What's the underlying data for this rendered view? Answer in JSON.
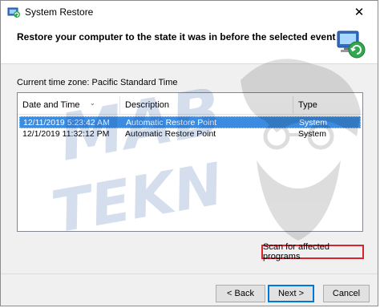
{
  "window": {
    "title": "System Restore",
    "close_glyph": "✕"
  },
  "header": {
    "text": "Restore your computer to the state it was in before the selected event",
    "icon": "system-restore-icon"
  },
  "timezone_label": "Current time zone: Pacific Standard Time",
  "table": {
    "columns": [
      "Date and Time",
      "Description",
      "Type"
    ],
    "rows": [
      {
        "date": "12/11/2019 5:23:42 AM",
        "description": "Automatic Restore Point",
        "type": "System",
        "selected": true
      },
      {
        "date": "12/1/2019 11:32:12 PM",
        "description": "Automatic Restore Point",
        "type": "System",
        "selected": false
      }
    ]
  },
  "buttons": {
    "scan": "Scan for affected programs",
    "back": "< Back",
    "next": "Next >",
    "cancel": "Cancel"
  },
  "watermark": {
    "line1": "MAB",
    "line2": "TEKN"
  },
  "colors": {
    "selection": "#3b8ce0",
    "highlight_border": "#d9232d",
    "default_button": "#0078d7"
  }
}
